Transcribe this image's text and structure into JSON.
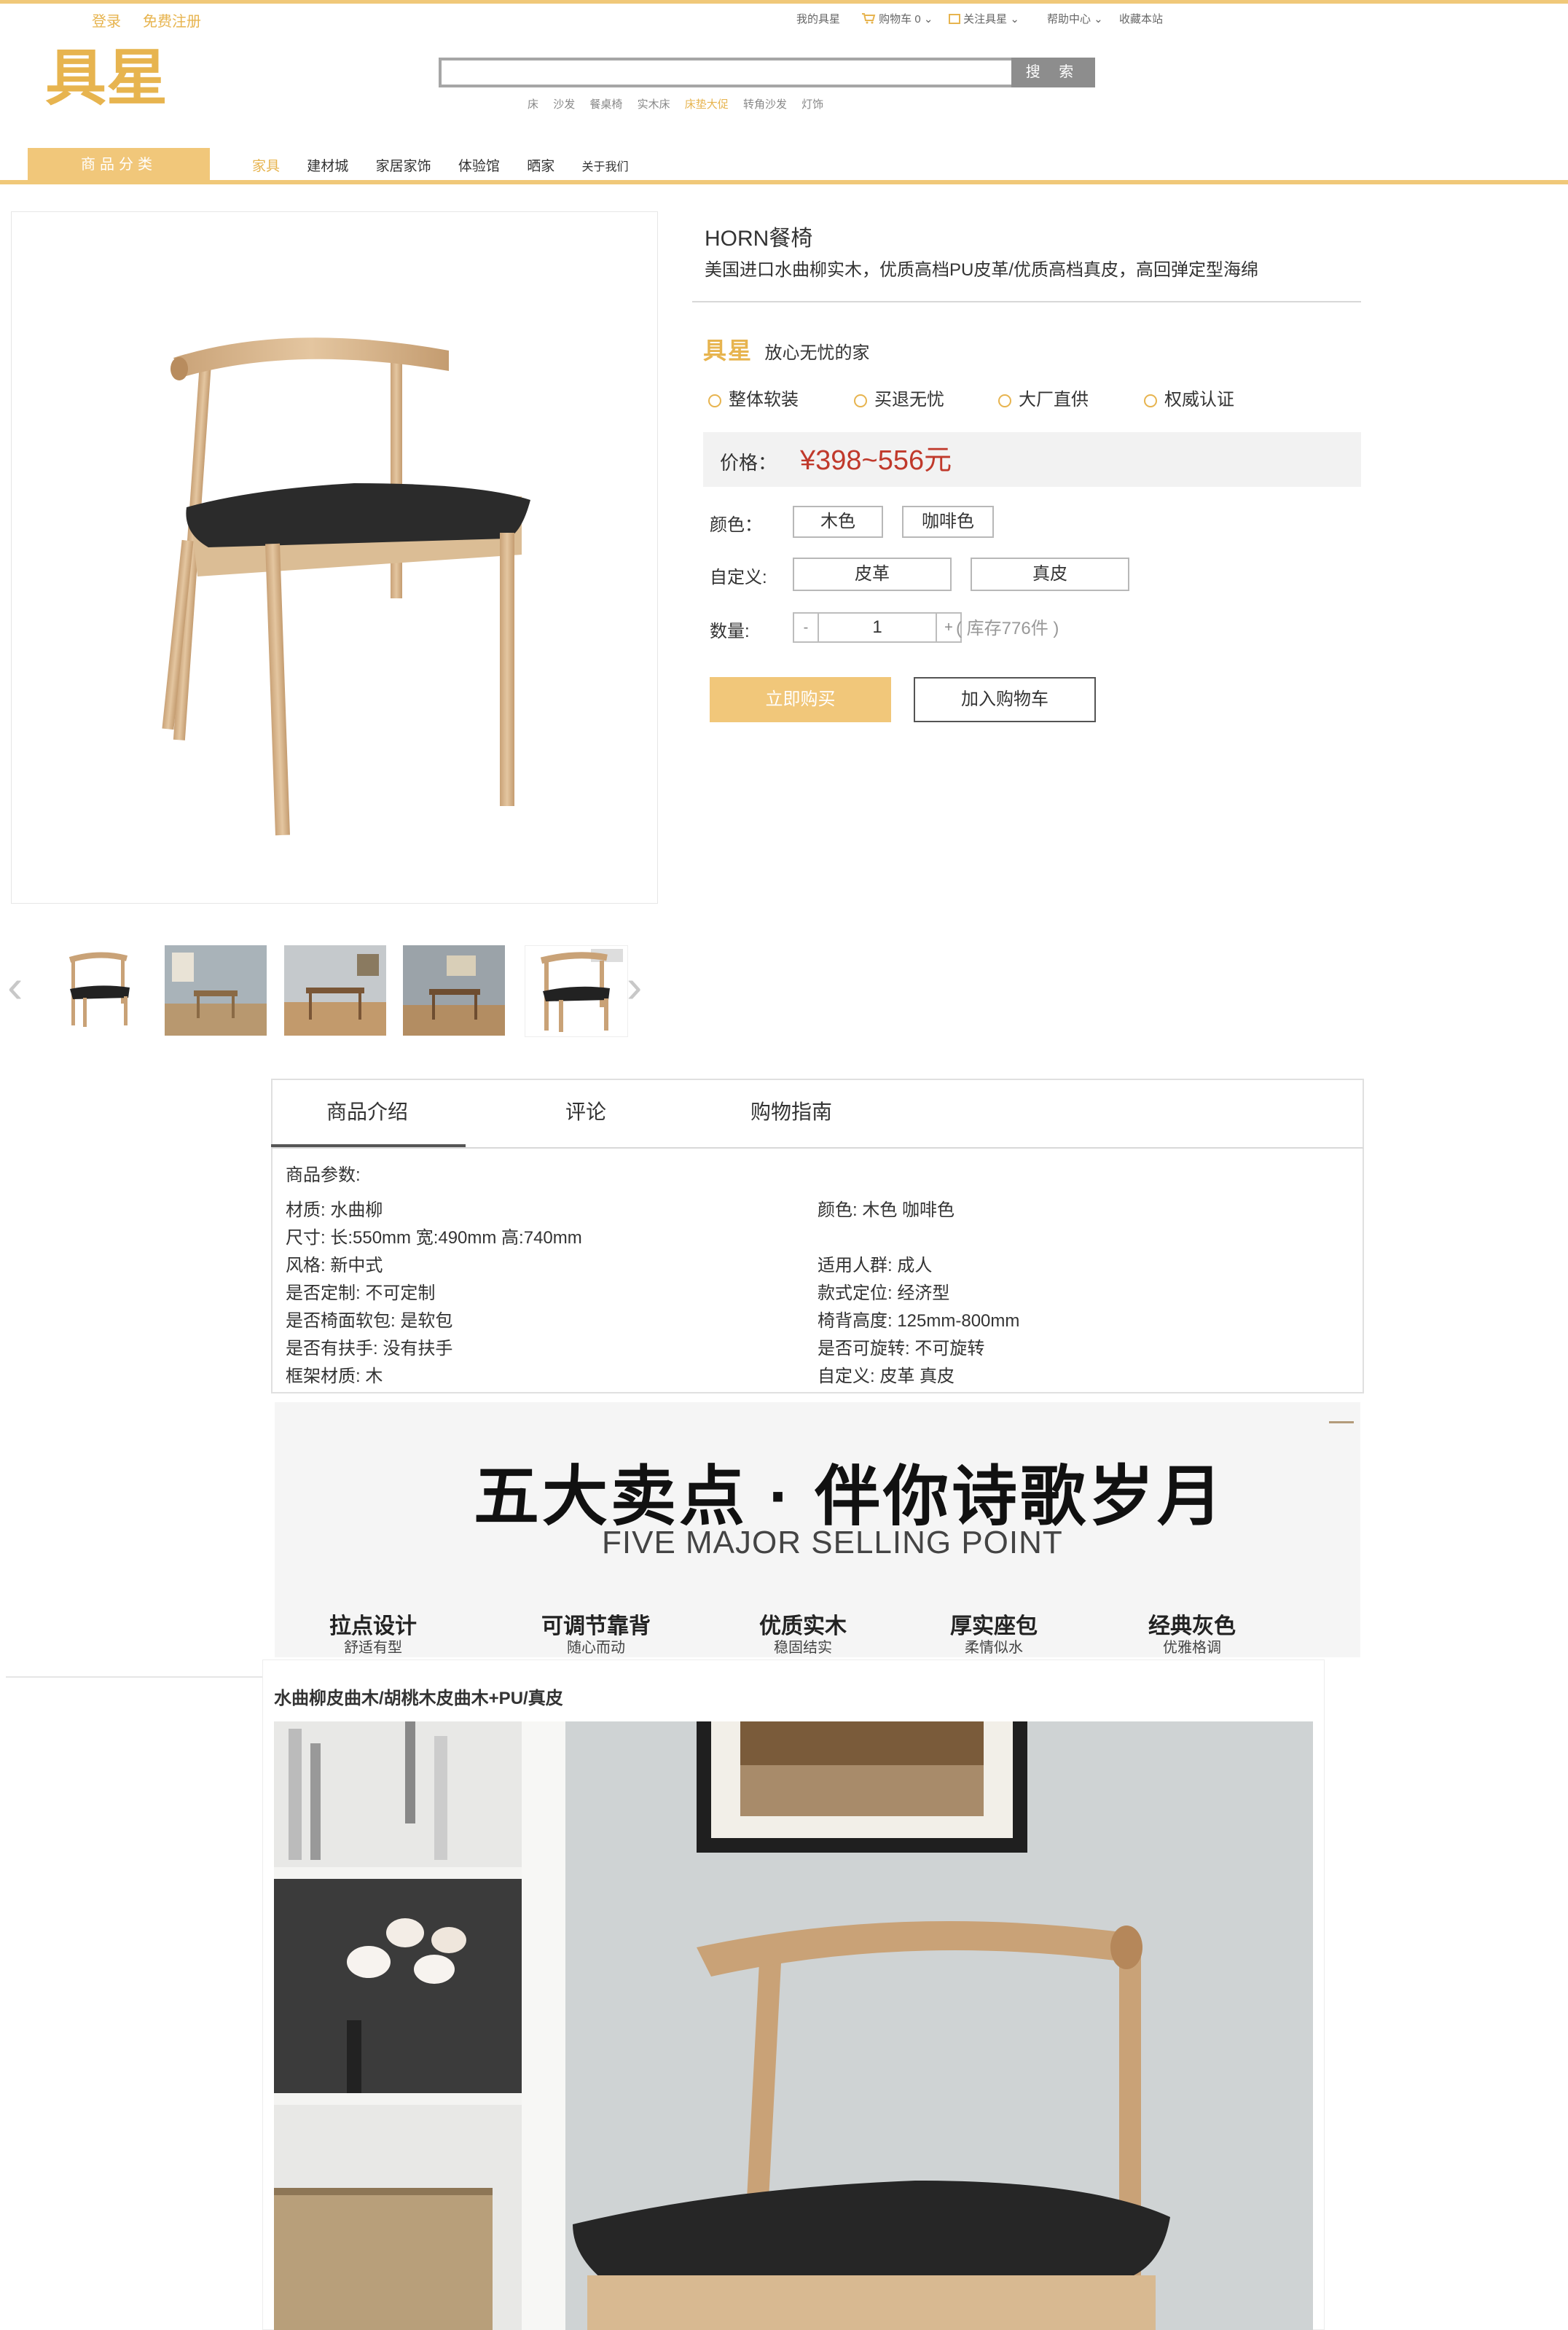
{
  "topbar": {
    "login": "登录",
    "register": "免费注册",
    "links": [
      "我的具星",
      "购物车 0",
      "关注具星",
      "帮助中心",
      "收藏本站"
    ]
  },
  "logo": {
    "text": "具星"
  },
  "search": {
    "placeholder": "",
    "button": "搜 索",
    "hot_words": [
      "床",
      "沙发",
      "餐桌椅",
      "实木床",
      "床垫大促",
      "转角沙发",
      "灯饰"
    ]
  },
  "nav": {
    "category_button": "商品分类",
    "items": [
      "家具",
      "建材城",
      "家居家饰",
      "体验馆",
      "晒家",
      "关于我们"
    ]
  },
  "product": {
    "title": "HORN餐椅",
    "subtitle": "美国进口水曲柳实木，优质高档PU皮革/优质高档真皮，高回弹定型海绵",
    "brand": "具星",
    "slogan": "放心无忧的家",
    "features": [
      "整体软装",
      "买退无忧",
      "大厂直供",
      "权威认证"
    ],
    "price_label": "价格：",
    "price": "¥398~556元",
    "color_label": "颜色：",
    "colors": [
      "木色",
      "咖啡色"
    ],
    "custom_label": "自定义:",
    "customs": [
      "皮革",
      "真皮"
    ],
    "qty_label": "数量:",
    "qty_minus": "-",
    "qty": "1",
    "qty_plus": "+",
    "stock": "( 库存776件 )",
    "buy_now": "立即购买",
    "add_cart": "加入购物车"
  },
  "tabs": [
    "商品介绍",
    "评论",
    "购物指南"
  ],
  "params": {
    "heading": "商品参数:",
    "left": [
      "材质: 水曲柳",
      "尺寸: 长:550mm   宽:490mm   高:740mm",
      "风格: 新中式",
      "是否定制: 不可定制",
      "是否椅面软包: 是软包",
      "是否有扶手: 没有扶手",
      "框架材质: 木"
    ],
    "right": [
      "颜色: 木色 咖啡色",
      "",
      "适用人群: 成人",
      "款式定位: 经济型",
      "椅背高度: 125mm-800mm",
      "是否可旋转: 不可旋转",
      "自定义: 皮革 真皮"
    ]
  },
  "banner": {
    "title": "五大卖点 · 伴你诗歌岁月",
    "subtitle": "FIVE MAJOR SELLING POINT",
    "points": [
      {
        "title": "拉点设计",
        "sub": "舒适有型"
      },
      {
        "title": "可调节靠背",
        "sub": "随心而动"
      },
      {
        "title": "优质实木",
        "sub": "稳固结实"
      },
      {
        "title": "厚实座包",
        "sub": "柔情似水"
      },
      {
        "title": "经典灰色",
        "sub": "优雅格调"
      }
    ]
  },
  "material": {
    "title": "水曲柳皮曲木/胡桃木皮曲木+PU/真皮"
  },
  "colors": {
    "accent": "#f1c77a",
    "price": "#c0392b",
    "brand": "#e7b44f"
  }
}
